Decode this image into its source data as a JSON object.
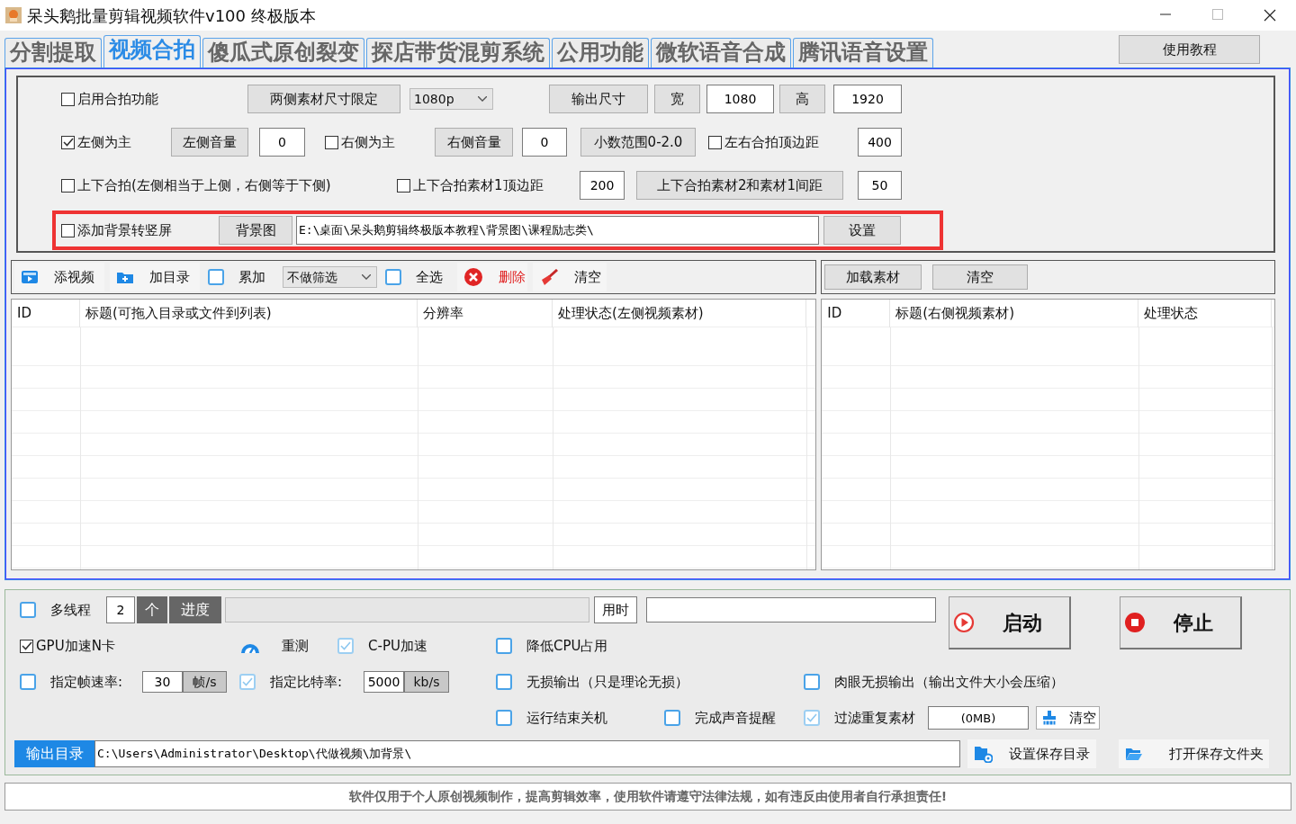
{
  "window": {
    "title": "呆头鹅批量剪辑视频软件v100 终极版本"
  },
  "tabs": [
    {
      "label": "分割提取",
      "selected": false
    },
    {
      "label": "视频合拍",
      "selected": true
    },
    {
      "label": "傻瓜式原创裂变",
      "selected": false
    },
    {
      "label": "探店带货混剪系统",
      "selected": false
    },
    {
      "label": "公用功能",
      "selected": false
    },
    {
      "label": "微软语音合成",
      "selected": false
    },
    {
      "label": "腾讯语音设置",
      "selected": false
    }
  ],
  "tutorial_button": "使用教程",
  "settings": {
    "rows": [
      {
        "items": [
          {
            "kind": "checkbox",
            "label": "启用合拍功能",
            "checked": false
          },
          {
            "kind": "button",
            "label": "两侧素材尺寸限定"
          },
          {
            "kind": "select",
            "value": "1080p"
          },
          {
            "kind": "button",
            "label": "输出尺寸"
          },
          {
            "kind": "button",
            "label": "宽"
          },
          {
            "kind": "input",
            "value": "1080"
          },
          {
            "kind": "button",
            "label": "高"
          },
          {
            "kind": "input",
            "value": "1920"
          }
        ]
      },
      {
        "items": [
          {
            "kind": "checkbox",
            "label": "左侧为主",
            "checked": true
          },
          {
            "kind": "button",
            "label": "左侧音量"
          },
          {
            "kind": "input",
            "value": "0"
          },
          {
            "kind": "checkbox",
            "label": "右侧为主",
            "checked": false
          },
          {
            "kind": "button",
            "label": "右侧音量"
          },
          {
            "kind": "input",
            "value": "0"
          },
          {
            "kind": "button",
            "label": "小数范围0-2.0"
          },
          {
            "kind": "checkbox",
            "label": "左右合拍顶边距",
            "checked": false
          },
          {
            "kind": "input",
            "value": "400"
          }
        ]
      },
      {
        "items": [
          {
            "kind": "checkbox",
            "label": "上下合拍(左侧相当于上侧，右侧等于下侧)",
            "checked": false
          },
          {
            "kind": "checkbox",
            "label": "上下合拍素材1顶边距",
            "checked": false
          },
          {
            "kind": "input",
            "value": "200"
          },
          {
            "kind": "button",
            "label": "上下合拍素材2和素材1间距"
          },
          {
            "kind": "input",
            "value": "50"
          }
        ]
      }
    ],
    "background_row": {
      "items": [
        {
          "kind": "checkbox",
          "label": "添加背景转竖屏",
          "checked": false
        },
        {
          "kind": "button",
          "label": "背景图"
        },
        {
          "kind": "input",
          "value": "E:\\桌面\\呆头鹅剪辑终极版本教程\\背景图\\课程励志类\\"
        },
        {
          "kind": "button",
          "label": "设置"
        }
      ]
    }
  },
  "toolbar": {
    "left": [
      {
        "kind": "icon_button",
        "label": "添视频"
      },
      {
        "kind": "icon_button",
        "label": "加目录"
      },
      {
        "kind": "flat_checkbox",
        "label": "累加",
        "checked": false
      },
      {
        "kind": "select",
        "value": "不做筛选"
      },
      {
        "kind": "flat_checkbox",
        "label": "全选",
        "checked": false
      },
      {
        "kind": "danger_button",
        "label": "删除"
      },
      {
        "kind": "icon_button",
        "label": "清空"
      }
    ],
    "right": [
      {
        "kind": "button",
        "label": "加载素材"
      },
      {
        "kind": "button",
        "label": "清空"
      }
    ]
  },
  "left_table": {
    "columns": [
      "ID",
      "标题(可拖入目录或文件到列表)",
      "分辨率",
      "处理状态(左侧视频素材)"
    ]
  },
  "right_table": {
    "columns": [
      "ID",
      "标题(右侧视频素材)",
      "处理状态"
    ]
  },
  "bottom": {
    "rows": [
      {
        "items": [
          {
            "kind": "flat_checkbox",
            "label": "多线程",
            "checked": false
          },
          {
            "kind": "input",
            "value": "2"
          },
          {
            "kind": "dark_label",
            "label": "个"
          },
          {
            "kind": "dark_label",
            "label": "进度"
          },
          {
            "kind": "progress",
            "level": 0
          },
          {
            "kind": "label_box",
            "label": "用时"
          },
          {
            "kind": "input"
          }
        ]
      },
      {
        "items": [
          {
            "kind": "checkbox",
            "label": "GPU加速N卡",
            "checked": true
          },
          {
            "kind": "icon_text",
            "label": "重测"
          },
          {
            "kind": "flat_checkbox",
            "label": "C-PU加速",
            "checked": true
          },
          {
            "kind": "flat_checkbox",
            "label": "降低CPU占用",
            "checked": false
          }
        ]
      },
      {
        "items": [
          {
            "kind": "flat_checkbox",
            "label": "指定帧速率:",
            "checked": false
          },
          {
            "kind": "input",
            "value": "30"
          },
          {
            "kind": "unit",
            "label": "帧/s"
          },
          {
            "kind": "flat_checkbox",
            "label": "指定比特率:",
            "checked": true
          },
          {
            "kind": "input",
            "value": "5000"
          },
          {
            "kind": "unit",
            "label": "kb/s"
          },
          {
            "kind": "flat_checkbox",
            "label": "无损输出（只是理论无损）",
            "checked": false
          },
          {
            "kind": "flat_checkbox",
            "label": "肉眼无损输出（输出文件大小会压缩）",
            "checked": false
          }
        ]
      },
      {
        "items": [
          {
            "kind": "flat_checkbox",
            "label": "运行结束关机",
            "checked": false
          },
          {
            "kind": "flat_checkbox",
            "label": "完成声音提醒",
            "checked": false
          },
          {
            "kind": "flat_checkbox",
            "label": "过滤重复素材",
            "checked": true
          },
          {
            "kind": "input",
            "value": "(0MB)"
          },
          {
            "kind": "icon_button",
            "label": "清空"
          }
        ]
      },
      {
        "items": [
          {
            "kind": "accent_label",
            "label": "输出目录"
          },
          {
            "kind": "input",
            "value": "C:\\Users\\Administrator\\Desktop\\代做视频\\加背景\\"
          },
          {
            "kind": "icon_button",
            "label": "设置保存目录"
          },
          {
            "kind": "icon_button",
            "label": "打开保存文件夹"
          }
        ]
      }
    ],
    "actions": [
      {
        "label": "启动"
      },
      {
        "label": "停止"
      }
    ]
  },
  "footer": "软件仅用于个人原创视频制作，提高剪辑效率，使用软件请遵守法律法规，如有违反由使用者自行承担责任!"
}
